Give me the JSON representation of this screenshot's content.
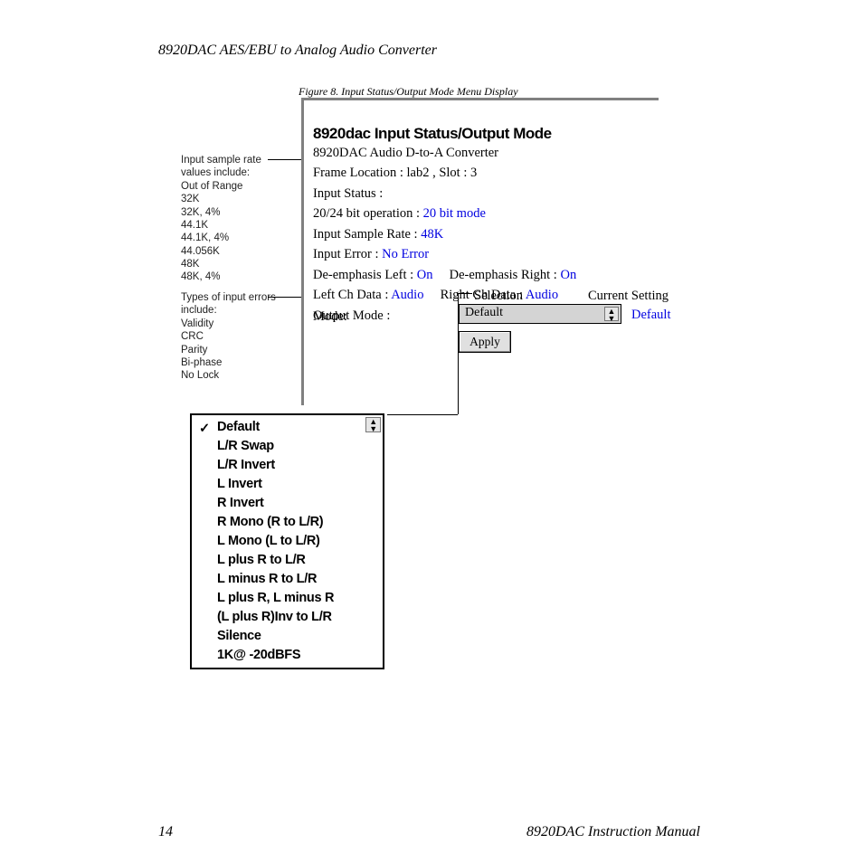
{
  "doc_title": "8920DAC AES/EBU to Analog Audio Converter",
  "figure_caption": "Figure 8.  Input Status/Output Mode Menu Display",
  "annot1_lead": "Input sample rate values include:",
  "annot1_items": [
    "Out of Range",
    "32K",
    "32K, 4%",
    "44.1K",
    "44.1K, 4%",
    "44.056K",
    "48K",
    "48K, 4%"
  ],
  "annot2_lead": "Types of input errors include:",
  "annot2_items": [
    "Validity",
    "CRC",
    "Parity",
    "Bi-phase",
    "No Lock"
  ],
  "ui": {
    "title": "8920dac Input Status/Output Mode",
    "subtitle": "8920DAC Audio D-to-A Converter",
    "frame_location_label": "Frame Location :",
    "frame_location_value": "lab2 , Slot : 3",
    "input_status_label": "Input Status :",
    "bit_op_label": "20/24 bit operation :",
    "bit_op_value": "20 bit mode",
    "sample_rate_label": "Input Sample Rate :",
    "sample_rate_value": "48K",
    "input_error_label": "Input Error :",
    "input_error_value": "No Error",
    "deemph_l_label": "De-emphasis Left :",
    "deemph_l_value": "On",
    "deemph_r_label": "De-emphasis Right :",
    "deemph_r_value": "On",
    "lch_label": "Left Ch Data :",
    "lch_value": "Audio",
    "rch_label": "Right Ch Data :",
    "rch_value": "Audio",
    "output_mode_label": "Output Mode :",
    "selection_label": "Selection",
    "current_label": "Current Setting",
    "mode_label": "Mode:",
    "dropdown_value": "Default",
    "current_value": "Default",
    "apply_label": "Apply"
  },
  "menu_options": [
    "Default",
    "L/R Swap",
    "L/R Invert",
    "L Invert",
    "R Invert",
    "R Mono (R to L/R)",
    "L Mono (L to L/R)",
    "L plus R to L/R",
    "L minus R to L/R",
    "L plus R, L minus R",
    "(L plus R)Inv to L/R",
    "Silence",
    "1K@ -20dBFS"
  ],
  "menu_selected_index": 0,
  "page_number": "14",
  "manual_label": "8920DAC Instruction Manual"
}
